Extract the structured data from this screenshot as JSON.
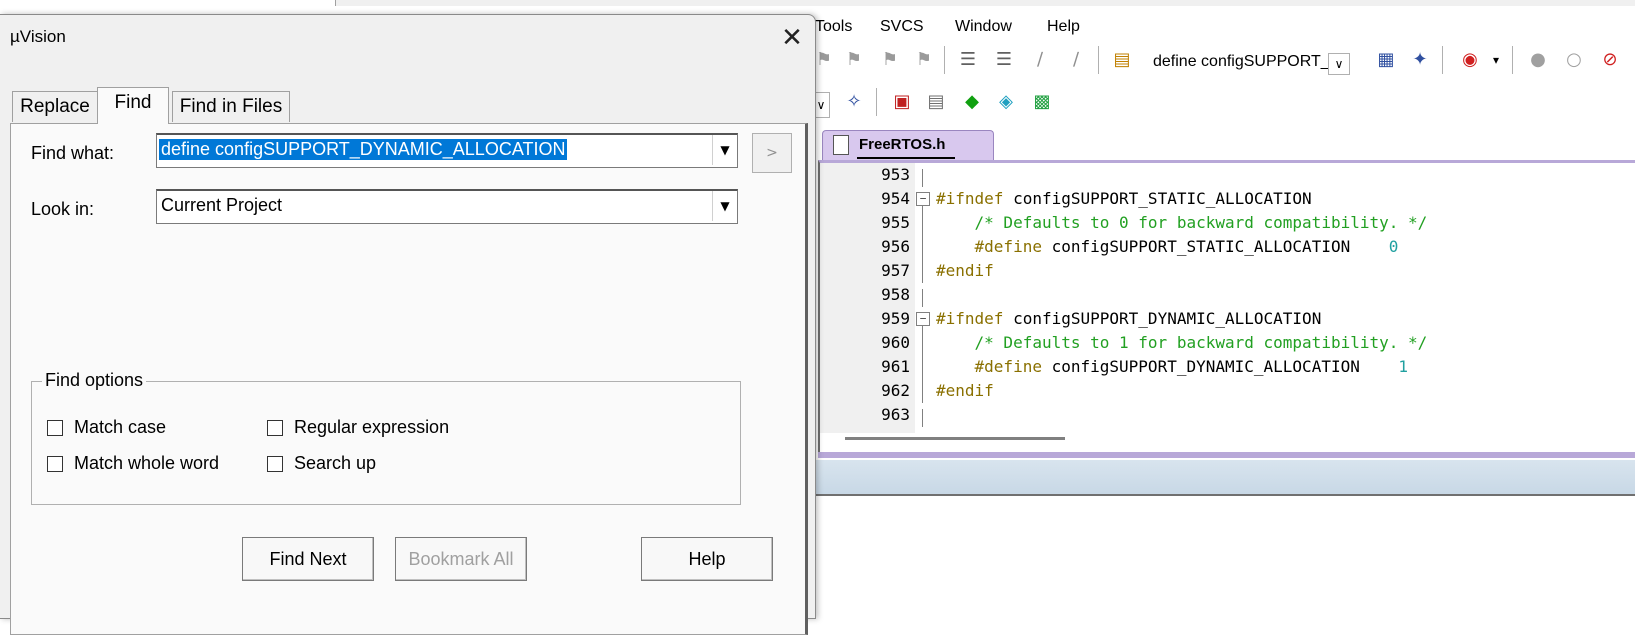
{
  "menubar": {
    "items": [
      "Tools",
      "SVCS",
      "Window",
      "Help"
    ]
  },
  "toolbar": {
    "find_combo_value": "define configSUPPORT_D"
  },
  "editor": {
    "active_tab": "FreeRTOS.h",
    "lines": [
      {
        "n": "953"
      },
      {
        "n": "954",
        "kw": "#ifndef",
        "text": " configSUPPORT_STATIC_ALLOCATION"
      },
      {
        "n": "955",
        "comment": "    /* Defaults to 0 for backward compatibility. */"
      },
      {
        "n": "956",
        "kw": "    #define",
        "text": " configSUPPORT_STATIC_ALLOCATION    ",
        "num": "0"
      },
      {
        "n": "957",
        "kw": "#endif"
      },
      {
        "n": "958"
      },
      {
        "n": "959",
        "kw": "#ifndef",
        "text": " configSUPPORT_DYNAMIC_ALLOCATION"
      },
      {
        "n": "960",
        "comment": "    /* Defaults to 1 for backward compatibility. */"
      },
      {
        "n": "961",
        "kw": "    #define",
        "text": " configSUPPORT_DYNAMIC_ALLOCATION    ",
        "num": "1"
      },
      {
        "n": "962",
        "kw": "#endif"
      },
      {
        "n": "963"
      }
    ]
  },
  "dialog": {
    "title": "µVision",
    "tabs": [
      "Replace",
      "Find",
      "Find in Files"
    ],
    "active_tab": "Find",
    "find_what_label": "Find what:",
    "find_what_value": "define configSUPPORT_DYNAMIC_ALLOCATION",
    "look_in_label": "Look in:",
    "look_in_value": "Current Project",
    "arrow_button": ">",
    "find_options_label": "Find options",
    "options": {
      "match_case": "Match case",
      "match_whole_word": "Match whole word",
      "regular_expression": "Regular expression",
      "search_up": "Search up"
    },
    "buttons": {
      "find_next": "Find Next",
      "bookmark_all": "Bookmark All",
      "help": "Help"
    }
  },
  "colors": {
    "selection": "#0078d7",
    "keyword": "#8a7000",
    "comment": "#22a022",
    "number": "#20a0a0",
    "tab_active": "#d8c8ee"
  }
}
